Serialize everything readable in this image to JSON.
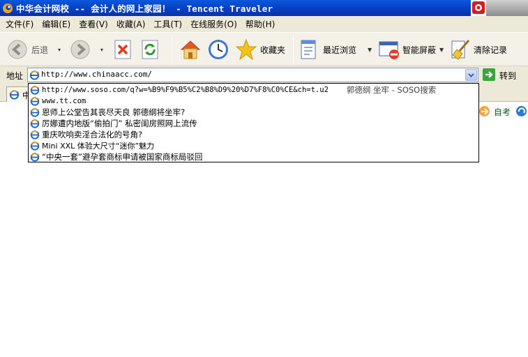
{
  "window": {
    "title": "中华会计网校 -- 会计人的网上家园！ - Tencent Traveler"
  },
  "menu": {
    "items": [
      "文件(F)",
      "编辑(E)",
      "查看(V)",
      "收藏(A)",
      "工具(T)",
      "在线服务(O)",
      "帮助(H)"
    ]
  },
  "toolbar": {
    "back_label": "后退",
    "favorites_label": "收藏夹",
    "recent_label": "最近浏览",
    "smart_block_label": "智能屏蔽",
    "clear_label": "清除记录"
  },
  "address": {
    "label": "地址",
    "value": "http://www.chinaacc.com/",
    "go_label": "转到"
  },
  "tab": {
    "label": "中"
  },
  "side": {
    "label": "自考"
  },
  "suggestions": [
    {
      "text": "http://www.soso.com/q?w=%B9%F9%B5%C2%B8%D9%20%D7%F8%C0%CE&ch=t.u2",
      "title": "郭德纲 坐牢 - SOSO搜索"
    },
    {
      "text": "www.tt.com",
      "title": ""
    },
    {
      "text": "恩师上公堂告其丧尽天良 郭德纲将坐牢?",
      "title": ""
    },
    {
      "text": "厉娜遭内地版“偷拍门” 私密闺房照网上流传",
      "title": ""
    },
    {
      "text": "重庆吹响卖淫合法化的号角?",
      "title": ""
    },
    {
      "text": "Mini XXL 体验大尺寸“迷你”魅力",
      "title": ""
    },
    {
      "text": "“中央一套”避孕套商标申请被国家商标局驳回",
      "title": ""
    }
  ]
}
